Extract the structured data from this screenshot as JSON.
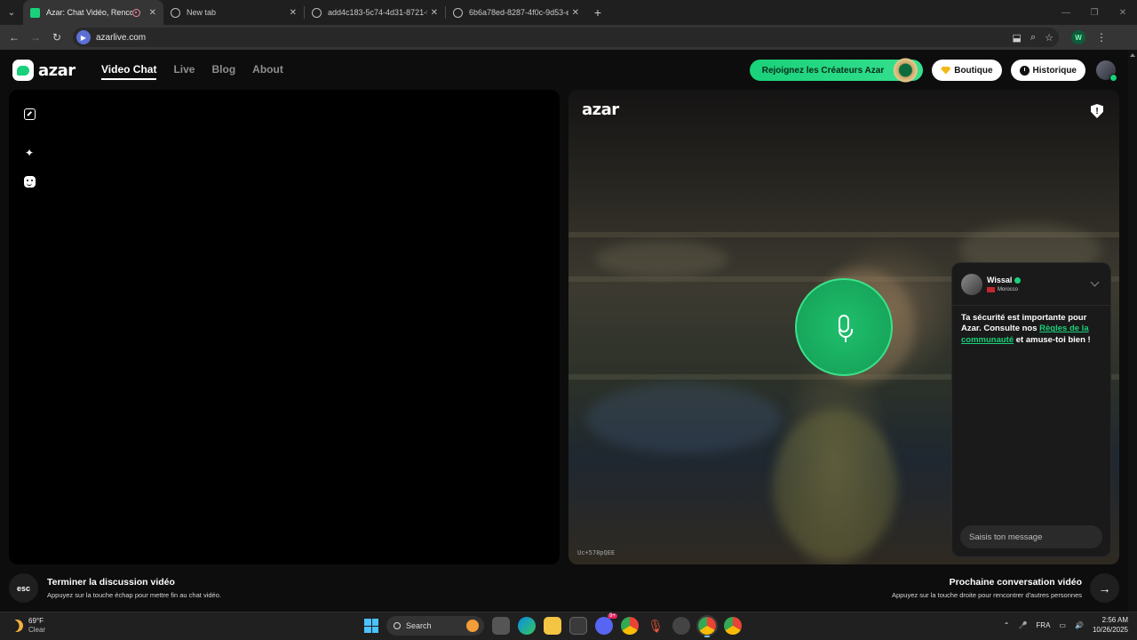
{
  "browser": {
    "tabs": [
      {
        "title": "Azar: Chat Vidéo, Rencontre",
        "active": true,
        "recording": true
      },
      {
        "title": "New tab",
        "active": false
      },
      {
        "title": "add4c183-5c74-4d31-8721-f2",
        "active": false
      },
      {
        "title": "6b6a78ed-8287-4f0c-9d53-e4",
        "active": false
      }
    ],
    "url": "azarlive.com",
    "profile_initial": "W"
  },
  "header": {
    "logo_text": "azar",
    "nav": [
      {
        "label": "Video Chat",
        "active": true
      },
      {
        "label": "Live",
        "active": false
      },
      {
        "label": "Blog",
        "active": false
      },
      {
        "label": "About",
        "active": false
      }
    ],
    "creators_label": "Rejoignez les Créateurs Azar",
    "boutique_label": "Boutique",
    "historique_label": "Historique"
  },
  "remote_video": {
    "logo_text": "azar",
    "partner_id": "Uc+578pQEE",
    "mic_state": "muted-prompt"
  },
  "chat": {
    "user_name": "Wissal",
    "country": "Morocco",
    "message_prefix": "Ta sécurité est importante pour Azar. Consulte nos ",
    "message_link": "Règles de la communauté",
    "message_suffix": " et amuse-toi bien !",
    "input_placeholder": "Saisis ton message"
  },
  "footer": {
    "esc_label": "esc",
    "end_title": "Terminer la discussion vidéo",
    "end_sub": "Appuyez sur la touche échap pour mettre fin au chat vidéo.",
    "next_title": "Prochaine conversation vidéo",
    "next_sub": "Appuyez sur la touche droite pour rencontrer d'autres personnes"
  },
  "taskbar": {
    "temperature": "69°F",
    "condition": "Clear",
    "search_label": "Search",
    "language": "FRA",
    "time": "2:56 AM",
    "date": "10/26/2025",
    "badge_count": "9+"
  },
  "colors": {
    "accent": "#19d17a",
    "background": "#0d0d0d",
    "panel": "#000000"
  }
}
